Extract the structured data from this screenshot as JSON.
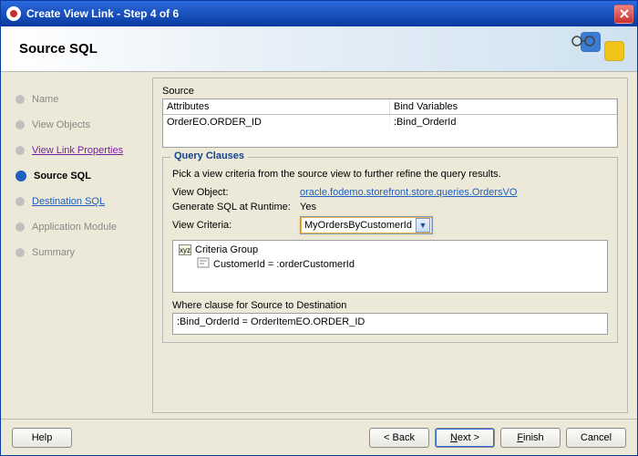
{
  "window": {
    "title": "Create View Link - Step 4 of 6"
  },
  "header": {
    "title": "Source SQL"
  },
  "steps": {
    "name": "Name",
    "view_objects": "View Objects",
    "view_link_properties": "View Link Properties",
    "source_sql": "Source SQL",
    "destination_sql": "Destination SQL",
    "application_module": "Application Module",
    "summary": "Summary"
  },
  "source": {
    "label": "Source",
    "col_attributes": "Attributes",
    "col_bind": "Bind Variables",
    "row_attr": "OrderEO.ORDER_ID",
    "row_bind": ":Bind_OrderId"
  },
  "query": {
    "legend": "Query Clauses",
    "instruction": "Pick a view criteria from the source view to further refine the query results.",
    "view_object_label": "View Object:",
    "view_object_value": "oracle.fodemo.storefront.store.queries.OrdersVO",
    "gen_sql_label": "Generate SQL at Runtime:",
    "gen_sql_value": "Yes",
    "criteria_label": "View Criteria:",
    "criteria_value": "MyOrdersByCustomerId",
    "tree_root": "Criteria Group",
    "tree_child": "CustomerId = :orderCustomerId",
    "where_label": "Where clause for Source to Destination",
    "where_value": ":Bind_OrderId = OrderItemEO.ORDER_ID"
  },
  "buttons": {
    "help": "Help",
    "back": "< Back",
    "next_u": "N",
    "next_rest": "ext >",
    "finish_u": "F",
    "finish_rest": "inish",
    "cancel": "Cancel"
  }
}
